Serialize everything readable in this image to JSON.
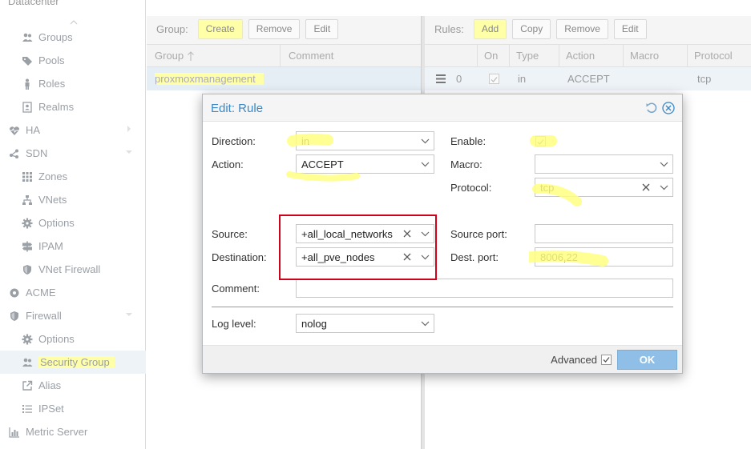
{
  "tree": {
    "top_label": "Datacenter",
    "items": [
      {
        "label": "Groups",
        "icon": "users-icon"
      },
      {
        "label": "Pools",
        "icon": "tags-icon"
      },
      {
        "label": "Roles",
        "icon": "male-icon"
      },
      {
        "label": "Realms",
        "icon": "address-book-icon"
      },
      {
        "label": "HA",
        "icon": "heartbeat-icon"
      },
      {
        "label": "SDN",
        "icon": "sdn-icon"
      },
      {
        "label": "Zones",
        "icon": "grid-icon"
      },
      {
        "label": "VNets",
        "icon": "network-icon"
      },
      {
        "label": "Options",
        "icon": "gear-icon"
      },
      {
        "label": "IPAM",
        "icon": "signpost-icon"
      },
      {
        "label": "VNet Firewall",
        "icon": "shield-icon"
      },
      {
        "label": "ACME",
        "icon": "certificate-icon"
      },
      {
        "label": "Firewall",
        "icon": "shield-icon"
      },
      {
        "label": "Options",
        "icon": "gear-icon"
      },
      {
        "label": "Security Group",
        "icon": "users-icon"
      },
      {
        "label": "Alias",
        "icon": "external-link-icon"
      },
      {
        "label": "IPSet",
        "icon": "list-icon"
      },
      {
        "label": "Metric Server",
        "icon": "bar-chart-icon"
      }
    ]
  },
  "group_panel": {
    "title": "Group:",
    "buttons": {
      "create": "Create",
      "remove": "Remove",
      "edit": "Edit"
    },
    "columns": {
      "group": "Group",
      "comment": "Comment"
    },
    "rows": [
      {
        "group": "proxmoxmanagement",
        "comment": ""
      }
    ]
  },
  "rules_panel": {
    "title": "Rules:",
    "buttons": {
      "add": "Add",
      "copy": "Copy",
      "remove": "Remove",
      "edit": "Edit"
    },
    "columns": {
      "on": "On",
      "type": "Type",
      "action": "Action",
      "macro": "Macro",
      "protocol": "Protocol"
    },
    "rows": [
      {
        "index": "0",
        "type": "in",
        "action": "ACCEPT",
        "protocol": "tcp"
      }
    ]
  },
  "dialog": {
    "title": "Edit: Rule",
    "labels": {
      "direction": "Direction:",
      "action": "Action:",
      "enable": "Enable:",
      "macro": "Macro:",
      "protocol": "Protocol:",
      "source": "Source:",
      "destination": "Destination:",
      "source_port": "Source port:",
      "dest_port": "Dest. port:",
      "comment": "Comment:",
      "log_level": "Log level:"
    },
    "values": {
      "direction": "in",
      "action": "ACCEPT",
      "macro": "",
      "protocol": "tcp",
      "source": "+all_local_networks",
      "destination": "+all_pve_nodes",
      "source_port": "",
      "dest_port": "8006,22",
      "comment": "",
      "log_level": "nolog"
    },
    "footer": {
      "advanced": "Advanced",
      "ok": "OK"
    }
  },
  "colors": {
    "highlight": "#ffffa8",
    "accent": "#3a88c5",
    "annotation_red": "#d0021b"
  }
}
